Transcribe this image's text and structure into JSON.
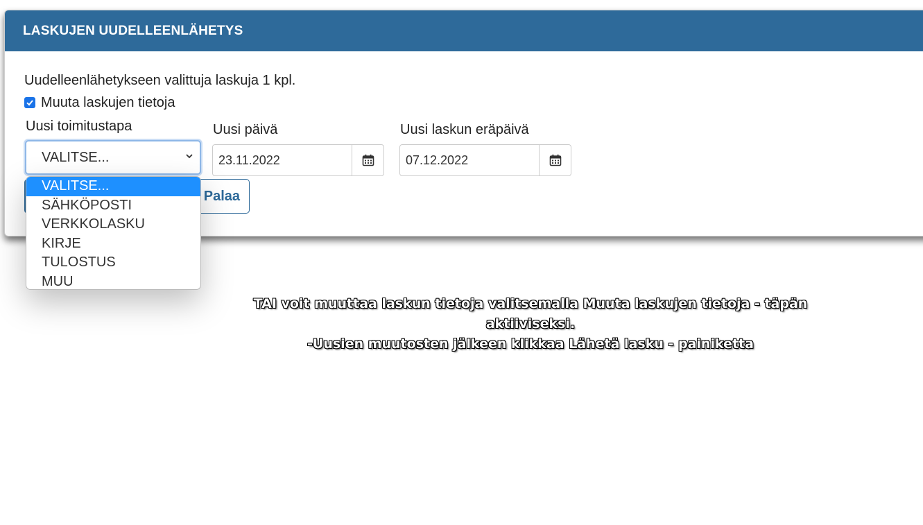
{
  "dialog": {
    "title": "LASKUJEN UUDELLEENLÄHETYS",
    "info_text": "Uudelleenlähetykseen valittuja laskuja 1 kpl.",
    "checkbox_label": "Muuta laskujen tietoja",
    "checkbox_checked": true,
    "delivery": {
      "label": "Uusi toimitustapa",
      "selected": "VALITSE...",
      "options": [
        "VALITSE...",
        "SÄHKÖPOSTI",
        "VERKKOLASKU",
        "KIRJE",
        "TULOSTUS",
        "MUU"
      ]
    },
    "new_date": {
      "label": "Uusi päivä",
      "value": "23.11.2022"
    },
    "due_date": {
      "label": "Uusi laskun eräpäivä",
      "value": "07.12.2022"
    },
    "back_button": "Palaa"
  },
  "instruction": {
    "line1": "TAI voit muuttaa laskun tietoja valitsemalla Muuta laskujen tietoja - täpän",
    "line2": "aktiiviseksi.",
    "line3": "-Uusien muutosten jälkeen klikkaa Lähetä lasku - painiketta"
  },
  "colors": {
    "header": "#2e6a9a",
    "selected_option": "#1e90ff"
  }
}
